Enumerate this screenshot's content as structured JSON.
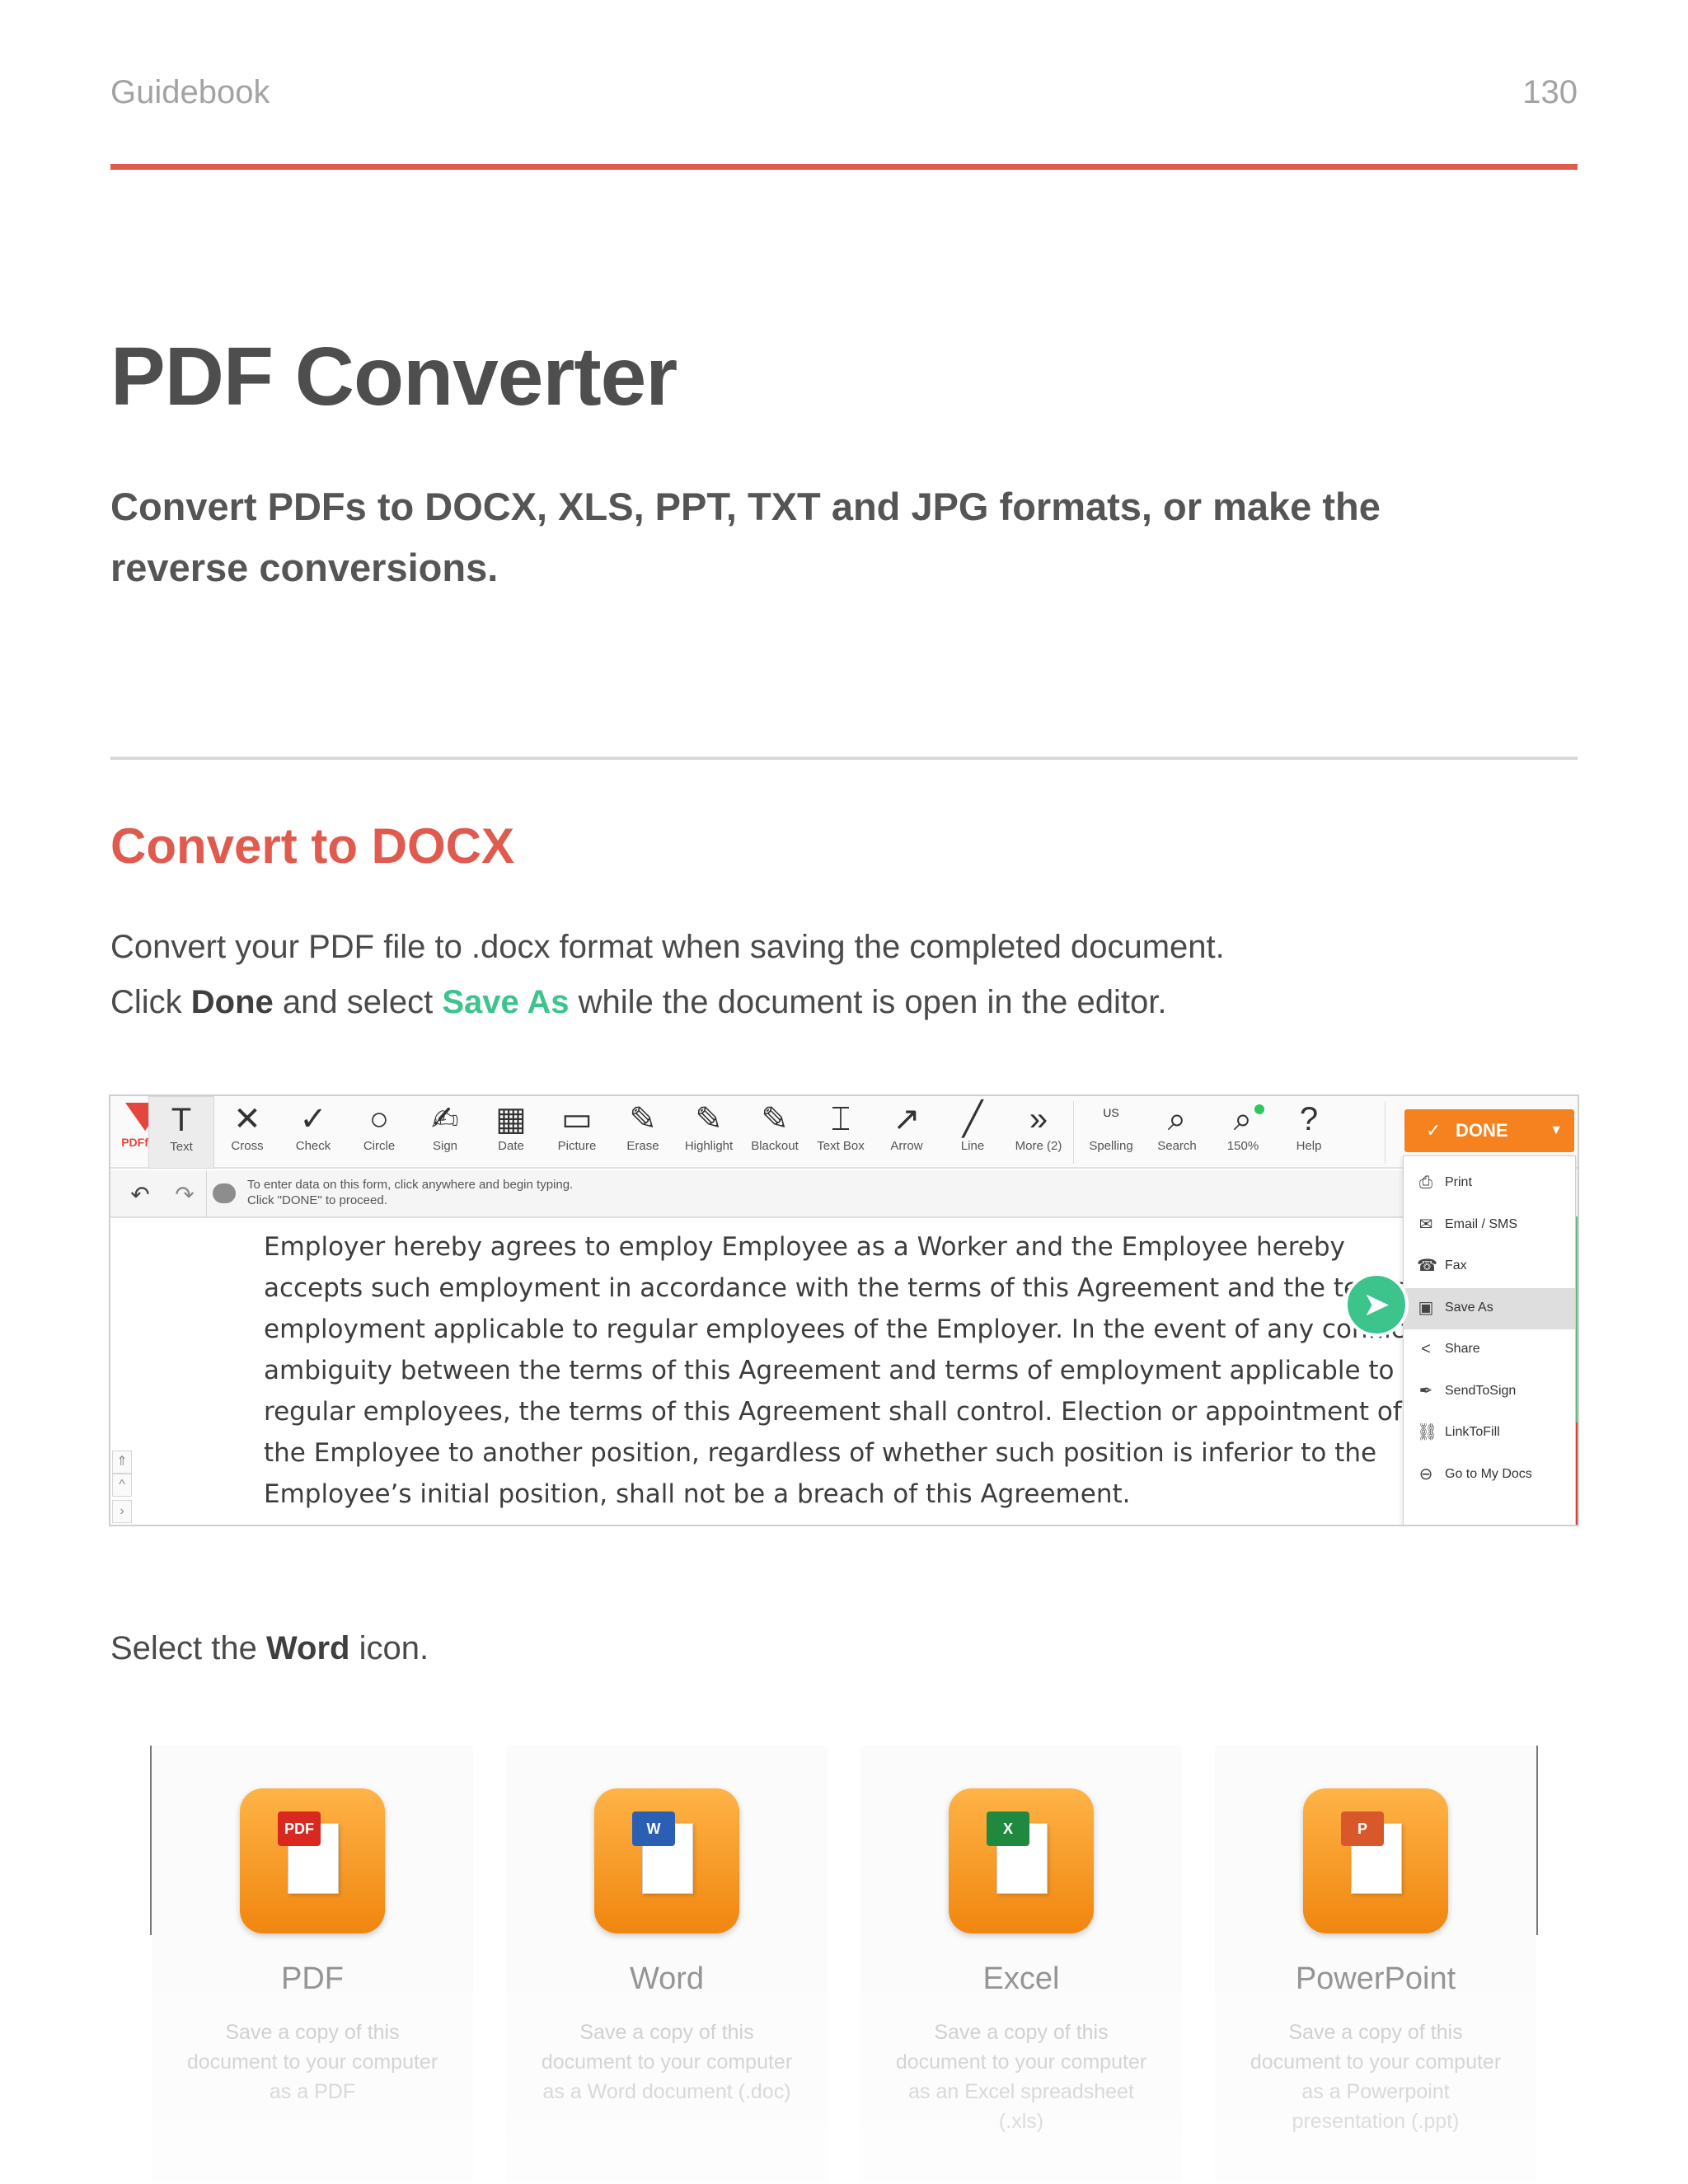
{
  "header": {
    "left": "Guidebook",
    "page_number": "130",
    "rule_color": "#e05a4e"
  },
  "title": "PDF Converter",
  "subtitle": "Convert PDFs to DOCX, XLS, PPT, TXT and JPG formats, or make the reverse conversions.",
  "section": {
    "title": "Convert to DOCX",
    "title_color": "#e05a4e",
    "line1": "Convert your PDF file to .docx format when saving the completed document.",
    "line2": {
      "pre": "Click ",
      "bold": "Done",
      "mid": " and select ",
      "accent": "Save As",
      "post": " while the document is open in the editor."
    },
    "accent_color": "#3cc48c",
    "line3": {
      "pre": "Select the ",
      "bold": "Word",
      "post": " icon."
    }
  },
  "editor": {
    "brand": "PDFfiller",
    "tools": [
      {
        "label": "Text",
        "icon": "text-icon",
        "glyph": "T"
      },
      {
        "label": "Cross",
        "icon": "cross-icon",
        "glyph": "✕"
      },
      {
        "label": "Check",
        "icon": "check-icon",
        "glyph": "✓"
      },
      {
        "label": "Circle",
        "icon": "circle-icon",
        "glyph": "○"
      },
      {
        "label": "Sign",
        "icon": "sign-icon",
        "glyph": "✍"
      },
      {
        "label": "Date",
        "icon": "date-icon",
        "glyph": "▦"
      },
      {
        "label": "Picture",
        "icon": "picture-icon",
        "glyph": "▭"
      },
      {
        "label": "Erase",
        "icon": "erase-icon",
        "glyph": "✎"
      },
      {
        "label": "Highlight",
        "icon": "highlight-icon",
        "glyph": "✎"
      },
      {
        "label": "Blackout",
        "icon": "blackout-icon",
        "glyph": "✎"
      },
      {
        "label": "Text Box",
        "icon": "text-box-icon",
        "glyph": "⌶"
      },
      {
        "label": "Arrow",
        "icon": "arrow-icon",
        "glyph": "↗"
      },
      {
        "label": "Line",
        "icon": "line-icon",
        "glyph": "╱"
      },
      {
        "label": "More (2)",
        "icon": "more-icon",
        "glyph": "»"
      },
      {
        "label": "Spelling",
        "icon": "spelling-icon",
        "glyph": "US"
      },
      {
        "label": "Search",
        "icon": "search-icon",
        "glyph": "⌕"
      },
      {
        "label": "150%",
        "icon": "zoom-icon",
        "glyph": "⌕"
      },
      {
        "label": "Help",
        "icon": "help-icon",
        "glyph": "?"
      }
    ],
    "done_label": "DONE",
    "hint_line1": "To enter data on this form, click anywhere and begin typing.",
    "hint_line2": "Click \"DONE\" to proceed.",
    "document_lines": [
      "Employer hereby agrees to employ Employee as a  Worker and the Employee hereby",
      "accepts such employment in accordance with the terms of this Agreement and the terms of",
      "employment applicable to regular employees of the Employer. In the event of any conflict or",
      "ambiguity between the terms of this Agreement and terms of employment applicable to",
      "regular employees, the terms of this Agreement shall control. Election or appointment of",
      "the Employee to another position, regardless of whether such position is inferior to the",
      "Employee’s initial position, shall not be a breach of this Agreement."
    ],
    "menu": [
      {
        "label": "Print",
        "icon": "print-icon",
        "glyph": "⎙"
      },
      {
        "label": "Email / SMS",
        "icon": "email-icon",
        "glyph": "✉"
      },
      {
        "label": "Fax",
        "icon": "fax-icon",
        "glyph": "☎"
      },
      {
        "label": "Save As",
        "icon": "save-icon",
        "glyph": "▣",
        "selected": true
      },
      {
        "label": "Share",
        "icon": "share-icon",
        "glyph": "<"
      },
      {
        "label": "SendToSign",
        "icon": "send-to-sign-icon",
        "glyph": "✒"
      },
      {
        "label": "LinkToFill",
        "icon": "link-icon",
        "glyph": "⛓"
      },
      {
        "label": "Go to My Docs",
        "icon": "go-to-docs-icon",
        "glyph": "⊖"
      }
    ],
    "done_color": "#f5811f"
  },
  "cards": [
    {
      "name": "PDF",
      "icon": "pdf-file-icon",
      "badge": "PDF",
      "badge_color": "#d8281f",
      "desc": "Save a copy of this document to your computer as a PDF"
    },
    {
      "name": "Word",
      "icon": "word-file-icon",
      "badge": "W",
      "badge_color": "#2b5fb3",
      "desc": "Save a copy of this document to your computer as a Word document (.doc)"
    },
    {
      "name": "Excel",
      "icon": "excel-file-icon",
      "badge": "X",
      "badge_color": "#1f8a3f",
      "desc": "Save a copy of this document to your computer as an Excel spreadsheet (.xls)"
    },
    {
      "name": "PowerPoint",
      "icon": "powerpoint-file-icon",
      "badge": "P",
      "badge_color": "#d9582b",
      "desc": "Save a copy of this document to your computer as a Powerpoint presentation (.ppt)"
    }
  ]
}
